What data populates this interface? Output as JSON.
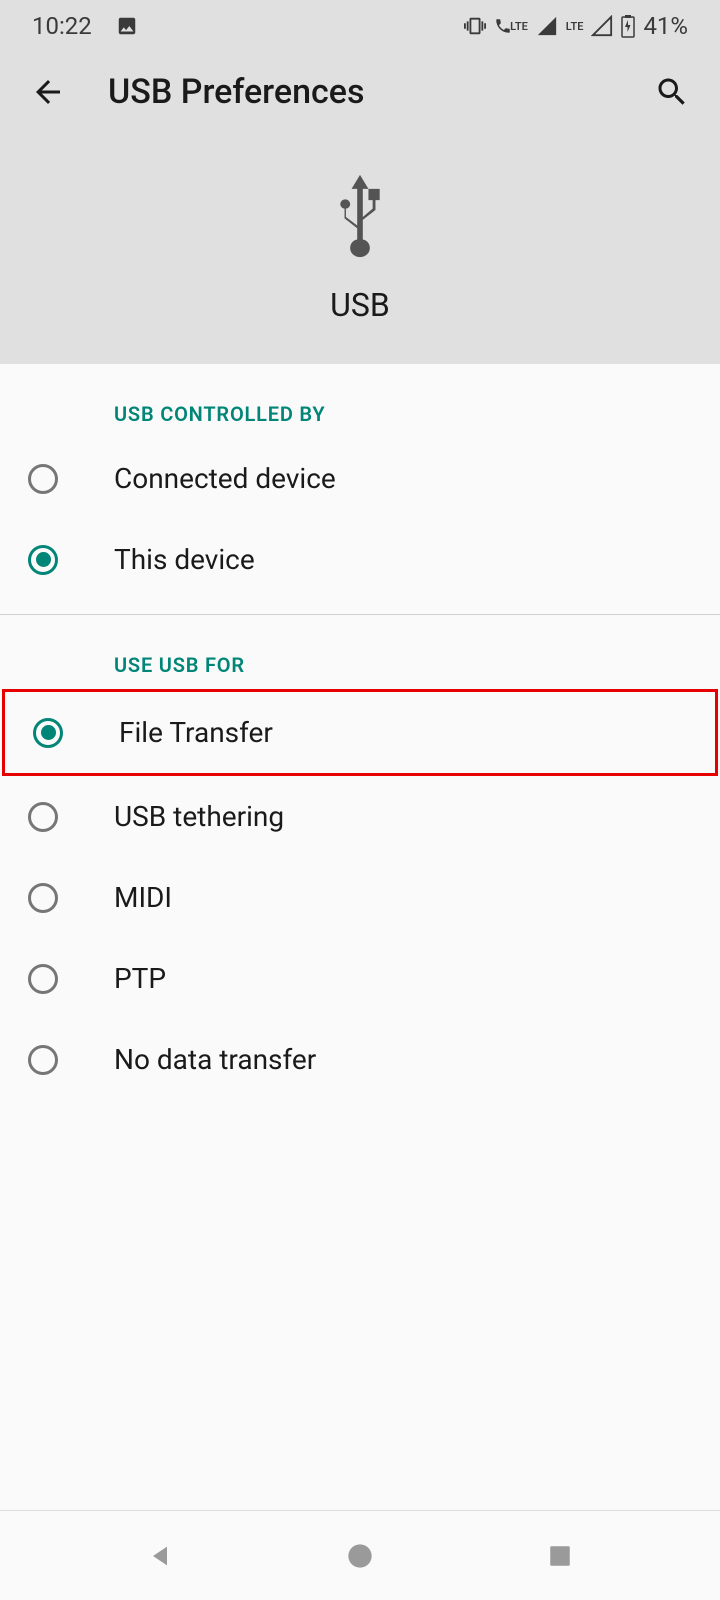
{
  "status": {
    "time": "10:22",
    "battery": "41%",
    "lte1": "LTE",
    "lte2": "LTE"
  },
  "header": {
    "title": "USB Preferences",
    "usb_label": "USB"
  },
  "sections": {
    "controlled_by": {
      "title": "USB CONTROLLED BY",
      "options": [
        {
          "label": "Connected device",
          "selected": false
        },
        {
          "label": "This device",
          "selected": true
        }
      ]
    },
    "use_for": {
      "title": "USE USB FOR",
      "options": [
        {
          "label": "File Transfer",
          "selected": true,
          "highlighted": true
        },
        {
          "label": "USB tethering",
          "selected": false
        },
        {
          "label": "MIDI",
          "selected": false
        },
        {
          "label": "PTP",
          "selected": false
        },
        {
          "label": "No data transfer",
          "selected": false
        }
      ]
    }
  }
}
